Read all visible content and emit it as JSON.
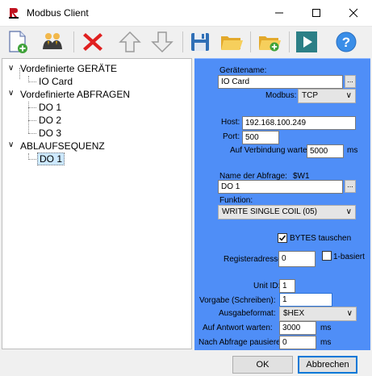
{
  "window": {
    "title": "Modbus Client",
    "minimize": "—",
    "maximize": "☐",
    "close": "✕"
  },
  "tree": {
    "groups": [
      {
        "label": "Vordefinierte GERÄTE",
        "expanded": true,
        "children": [
          "IO Card"
        ]
      },
      {
        "label": "Vordefinierte ABFRAGEN",
        "expanded": true,
        "children": [
          "DO 1",
          "DO 2",
          "DO 3"
        ]
      },
      {
        "label": "ABLAUFSEQUENZ",
        "expanded": true,
        "children": [
          "DO 1"
        ]
      }
    ],
    "selected": "DO 1"
  },
  "device": {
    "name_label": "Gerätename:",
    "name_value": "IO Card",
    "ellipsis": "...",
    "modbus_label": "Modbus:",
    "modbus_value": "TCP",
    "host_label": "Host:",
    "host_value": "192.168.100.249",
    "port_label": "Port:",
    "port_value": "500",
    "wait_label": "Auf Verbindung warten:",
    "wait_value": "5000",
    "wait_unit": "ms"
  },
  "query": {
    "name_label": "Name der Abfrage:",
    "name_var": "$W1",
    "name_value": "DO 1",
    "ellipsis": "...",
    "function_label": "Funktion:",
    "function_value": "WRITE SINGLE COIL (05)",
    "bytes_swap_label": "BYTES tauschen",
    "bytes_swap_checked": true,
    "register_label": "Registeradresse:",
    "register_value": "0",
    "one_based_label": "1-basiert",
    "one_based_checked": false,
    "unit_id_label": "Unit ID:",
    "unit_id_value": "1",
    "write_label": "Vorgabe (Schreiben):",
    "write_value": "1",
    "output_format_label": "Ausgabeformat:",
    "output_format_value": "$HEX",
    "response_wait_label": "Auf Antwort warten:",
    "response_wait_value": "3000",
    "response_wait_unit": "ms",
    "pause_label": "Nach Abfrage pausieren:",
    "pause_value": "0",
    "pause_unit": "ms"
  },
  "buttons": {
    "ok": "OK",
    "cancel": "Abbrechen"
  },
  "toolbar": {
    "icons": [
      "new-document-icon",
      "users-icon",
      "delete-icon",
      "arrow-up-icon",
      "arrow-down-icon",
      "save-icon",
      "open-folder-icon",
      "new-folder-icon",
      "run-icon",
      "help-icon"
    ]
  },
  "colors": {
    "panel_blue": "#4f8ef7",
    "delete_red": "#e02020",
    "run_teal": "#2c7f86",
    "help_blue": "#3a8ee8"
  }
}
